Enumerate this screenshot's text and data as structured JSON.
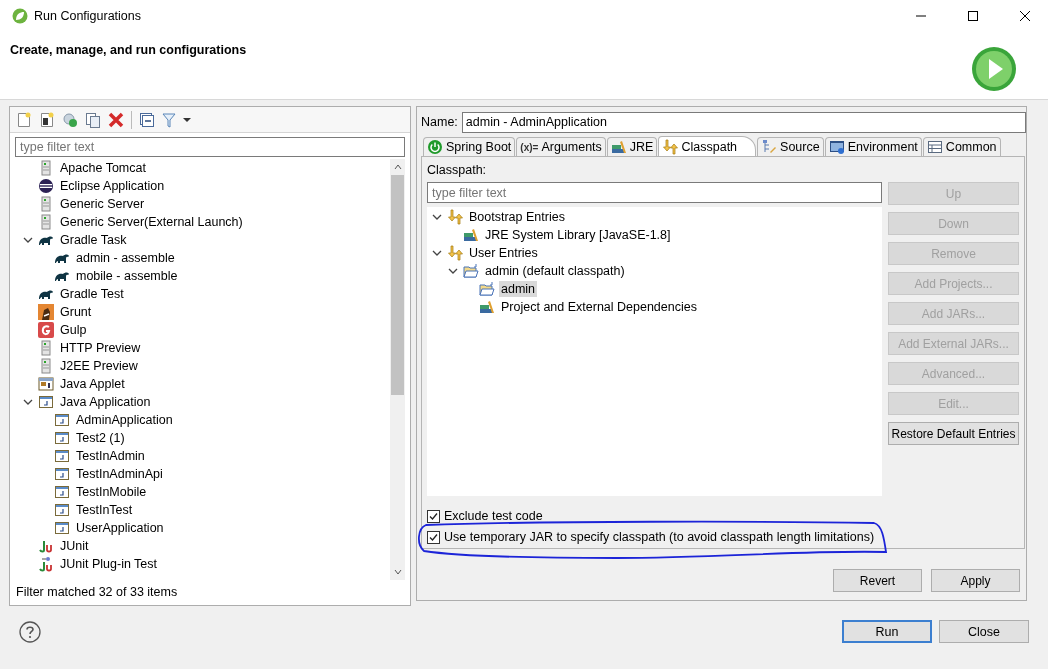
{
  "window": {
    "title": "Run Configurations"
  },
  "header": {
    "title": "Create, manage, and run configurations"
  },
  "config_list": {
    "filter_placeholder": "type filter text",
    "tree": [
      {
        "label": "Apache Tomcat",
        "kind": "server"
      },
      {
        "label": "Eclipse Application",
        "kind": "eclipse"
      },
      {
        "label": "Generic Server",
        "kind": "server"
      },
      {
        "label": "Generic Server(External Launch)",
        "kind": "server"
      },
      {
        "label": "Gradle Task",
        "kind": "gradle",
        "expanded": true,
        "children": [
          {
            "label": "admin - assemble",
            "kind": "gradle"
          },
          {
            "label": "mobile - assemble",
            "kind": "gradle"
          }
        ]
      },
      {
        "label": "Gradle Test",
        "kind": "gradle"
      },
      {
        "label": "Grunt",
        "kind": "grunt"
      },
      {
        "label": "Gulp",
        "kind": "gulp"
      },
      {
        "label": "HTTP Preview",
        "kind": "server"
      },
      {
        "label": "J2EE Preview",
        "kind": "server"
      },
      {
        "label": "Java Applet",
        "kind": "applet"
      },
      {
        "label": "Java Application",
        "kind": "java",
        "expanded": true,
        "children": [
          {
            "label": "AdminApplication",
            "kind": "java"
          },
          {
            "label": "Test2 (1)",
            "kind": "java"
          },
          {
            "label": "TestInAdmin",
            "kind": "java"
          },
          {
            "label": "TestInAdminApi",
            "kind": "java"
          },
          {
            "label": "TestInMobile",
            "kind": "java"
          },
          {
            "label": "TestInTest",
            "kind": "java"
          },
          {
            "label": "UserApplication",
            "kind": "java"
          }
        ]
      },
      {
        "label": "JUnit",
        "kind": "junit"
      },
      {
        "label": "JUnit Plug-in Test",
        "kind": "junit-plugin"
      }
    ],
    "status": "Filter matched 32 of 33 items"
  },
  "editor": {
    "name_label": "Name:",
    "name_value": "admin - AdminApplication",
    "tabs": [
      {
        "label": "Spring Boot",
        "kind": "power",
        "selected": false
      },
      {
        "label": "Arguments",
        "kind": "variables",
        "icon_text": "(x)=",
        "selected": false
      },
      {
        "label": "JRE",
        "kind": "books",
        "selected": false
      },
      {
        "label": "Classpath",
        "kind": "arrows",
        "selected": true
      },
      {
        "label": "Source",
        "kind": "hierarchy",
        "selected": false
      },
      {
        "label": "Environment",
        "kind": "monitor",
        "selected": false
      },
      {
        "label": "Common",
        "kind": "table",
        "selected": false
      }
    ],
    "classpath_label": "Classpath:",
    "filter_placeholder": "type filter text",
    "tree": [
      {
        "label": "Bootstrap Entries",
        "kind": "arrows",
        "expanded": true,
        "selected": false,
        "children": [
          {
            "label": "JRE System Library [JavaSE-1.8]",
            "kind": "books",
            "selected": false
          }
        ]
      },
      {
        "label": "User Entries",
        "kind": "arrows",
        "expanded": true,
        "selected": false,
        "children": [
          {
            "label": "admin (default classpath)",
            "kind": "folder",
            "expanded": true,
            "selected": false,
            "children": [
              {
                "label": "admin",
                "kind": "folder",
                "selected": true
              },
              {
                "label": "Project and External Dependencies",
                "kind": "books",
                "selected": false
              }
            ]
          }
        ]
      }
    ],
    "side_buttons": [
      {
        "label": "Up",
        "disabled": true
      },
      {
        "label": "Down",
        "disabled": true
      },
      {
        "label": "Remove",
        "disabled": true
      },
      {
        "label": "Add Projects...",
        "disabled": true
      },
      {
        "label": "Add JARs...",
        "disabled": true
      },
      {
        "label": "Add External JARs...",
        "disabled": true
      },
      {
        "label": "Advanced...",
        "disabled": true
      },
      {
        "label": "Edit...",
        "disabled": true
      },
      {
        "label": "Restore Default Entries",
        "disabled": false
      }
    ],
    "checkboxes": [
      {
        "label": "Exclude test code",
        "checked": true
      },
      {
        "label": "Use temporary JAR to specify classpath (to avoid classpath length limitations)",
        "checked": true
      }
    ],
    "buttons": [
      "Revert",
      "Apply"
    ]
  },
  "footer": {
    "buttons": [
      {
        "label": "Run",
        "default": true
      },
      {
        "label": "Close",
        "default": false
      }
    ]
  }
}
